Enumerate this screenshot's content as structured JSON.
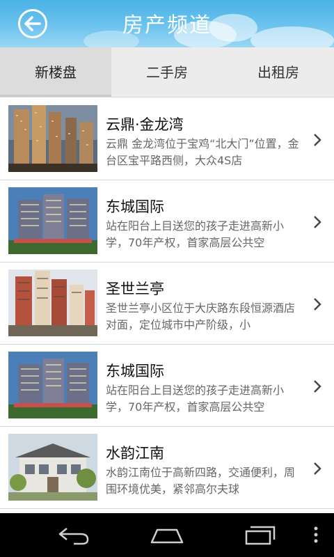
{
  "header": {
    "title": "房产频道",
    "back_icon": "back-arrow-icon",
    "bg_color": "#4ab2e6"
  },
  "tabs": [
    {
      "label": "新楼盘",
      "active": true
    },
    {
      "label": "二手房",
      "active": false
    },
    {
      "label": "出租房",
      "active": false
    }
  ],
  "listings": [
    {
      "name": "云鼎·金龙湾",
      "desc": "云鼎 金龙湾位于宝鸡“北大门”位置，金台区宝平路西侧，大众4S店",
      "thumb": "tower-dusk"
    },
    {
      "name": "东城国际",
      "desc": "站在阳台上目送您的孩子走进高新小学，70年产权，首家高层公共空",
      "thumb": "twin-towers-night"
    },
    {
      "name": "圣世兰亭",
      "desc": "圣世兰亭小区位于大庆路东段恒源酒店对面，定位城市中产阶级，小",
      "thumb": "red-towers"
    },
    {
      "name": "东城国际",
      "desc": "站在阳台上目送您的孩子走进高新小学，70年产权，首家高层公共空",
      "thumb": "twin-towers-night"
    },
    {
      "name": "水韵江南",
      "desc": "水韵江南位于高新四路，交通便利，周围环境优美，紧邻高尔夫球",
      "thumb": "villa"
    }
  ],
  "navbar": {
    "buttons": [
      "back-nav-icon",
      "home-nav-icon",
      "recent-apps-icon",
      "menu-overflow-icon"
    ]
  }
}
